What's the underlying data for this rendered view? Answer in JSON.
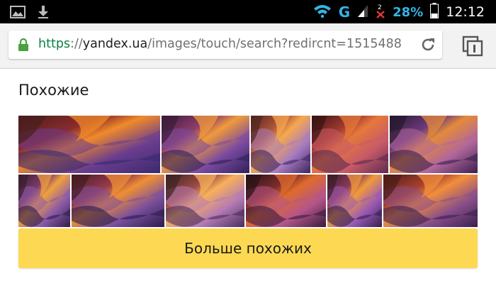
{
  "status_bar": {
    "icons_left": [
      "image-icon",
      "download-icon"
    ],
    "network_type": "G",
    "battery_percent": "28%",
    "time": "12:12",
    "colors": {
      "accent": "#33b5e5",
      "background": "#000000"
    }
  },
  "address_bar": {
    "scheme": "https",
    "separator": "://",
    "host": "yandex.ua",
    "path": "/images/touch/search?redircnt=1515488",
    "colors": {
      "scheme": "#0b8043",
      "lock": "#48a23f"
    }
  },
  "similar": {
    "heading": "Похожие",
    "row1": [
      {
        "name": "thumb-1",
        "palette": [
          "#4a1e1e",
          "#8b2c2c",
          "#f08a2a",
          "#6a3d8f",
          "#3b2a6e"
        ]
      },
      {
        "name": "thumb-2",
        "palette": [
          "#3a1c3a",
          "#8e3d6b",
          "#f09b3a",
          "#7a4aa0",
          "#2f2058"
        ]
      },
      {
        "name": "thumb-3",
        "palette": [
          "#52261e",
          "#b1553a",
          "#f6a84e",
          "#a77bc0",
          "#3d2560"
        ]
      },
      {
        "name": "thumb-4",
        "palette": [
          "#3c1414",
          "#a23a30",
          "#e6783a",
          "#c75a68",
          "#5d2a50"
        ]
      },
      {
        "name": "thumb-5",
        "palette": [
          "#281830",
          "#6b3a7a",
          "#e48a3c",
          "#b0669a",
          "#3b1f4f"
        ]
      }
    ],
    "row2": [
      {
        "name": "thumb-6",
        "palette": [
          "#3a1e2e",
          "#7d3a6b",
          "#f0a03e",
          "#8a5aa8",
          "#2f1d4a"
        ]
      },
      {
        "name": "thumb-7",
        "palette": [
          "#451d24",
          "#963a4c",
          "#ef8f34",
          "#7b4f9c",
          "#2a1c4c"
        ]
      },
      {
        "name": "thumb-8",
        "palette": [
          "#3f2424",
          "#9b4a44",
          "#f7b05a",
          "#b47ab4",
          "#4a2d5e"
        ]
      },
      {
        "name": "thumb-9",
        "palette": [
          "#2a1218",
          "#7a2c2c",
          "#df6b2c",
          "#b4558a",
          "#3a1a3e"
        ]
      },
      {
        "name": "thumb-10",
        "palette": [
          "#3d1c2a",
          "#8a3a5a",
          "#f19a3a",
          "#9a5ab4",
          "#33204f"
        ]
      },
      {
        "name": "thumb-11",
        "palette": [
          "#4b1c18",
          "#a7402e",
          "#f28e3c",
          "#8a4f88",
          "#3a2050"
        ]
      }
    ],
    "more_button": "Больше похожих",
    "colors": {
      "button": "#fdd953"
    }
  }
}
